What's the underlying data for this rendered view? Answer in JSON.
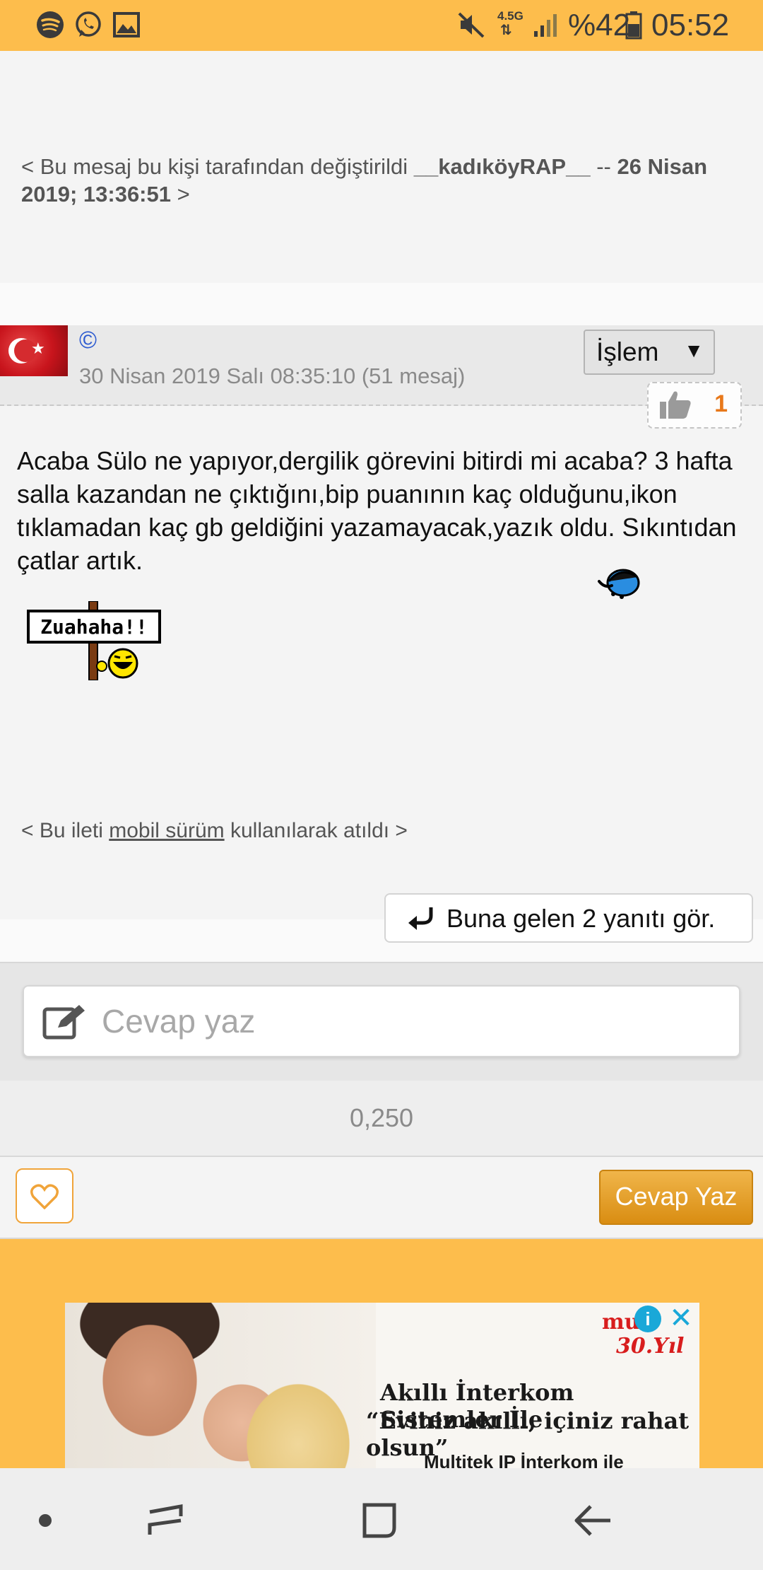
{
  "status_bar": {
    "icons": [
      "spotify-icon",
      "whatsapp-icon",
      "gallery-icon",
      "mute-icon",
      "signal-icon",
      "battery-icon"
    ],
    "network": "4.5G",
    "battery": "%42",
    "time": "05:52"
  },
  "edit_note": {
    "prefix": "< Bu mesaj bu kişi tarafından değiştirildi",
    "user": "__kadıköyRAP__",
    "separator": "--",
    "date": "26 Nisan 2019; 13:36:51",
    "suffix": ">"
  },
  "post": {
    "author_symbol": "©",
    "date_text": "30 Nisan 2019 Salı 08:35:10 (51 mesaj)",
    "action_menu": "İşlem",
    "like_count": "1",
    "body": "Acaba Sülo ne yapıyor,dergilik görevini bitirdi mi acaba? 3 hafta salla kazandan ne çıktığını,bip puanının kaç olduğunu,ikon tıklamadan kaç gb geldiğini yazamayacak,yazık oldu. Sıkıntıdan çatlar artık.",
    "sign_text": "Zuahaha!!",
    "mobile_note": {
      "prefix": "< Bu ileti",
      "link": "mobil sürüm",
      "suffix": "kullanılarak atıldı >"
    },
    "replies_button": "Buna gelen 2 yanıtı gör."
  },
  "reply": {
    "placeholder": "Cevap yaz"
  },
  "timing": "0,250",
  "actions": {
    "reply_button": "Cevap Yaz"
  },
  "ad": {
    "brand": "mu",
    "brand_sub": "30.Yıl",
    "line1": "Akıllı İnterkom Sistemler İle",
    "line2": "“Eviniz akıllı, içiniz rahat olsun”",
    "line3": "Multitek IP İnterkom ile"
  },
  "colors": {
    "status_bar": "#fdbd4c",
    "accent_orange": "#e8781a",
    "button_gradient_top": "#f0b54a",
    "button_gradient_bottom": "#d98d12",
    "link_blue": "#2d5bd0"
  }
}
